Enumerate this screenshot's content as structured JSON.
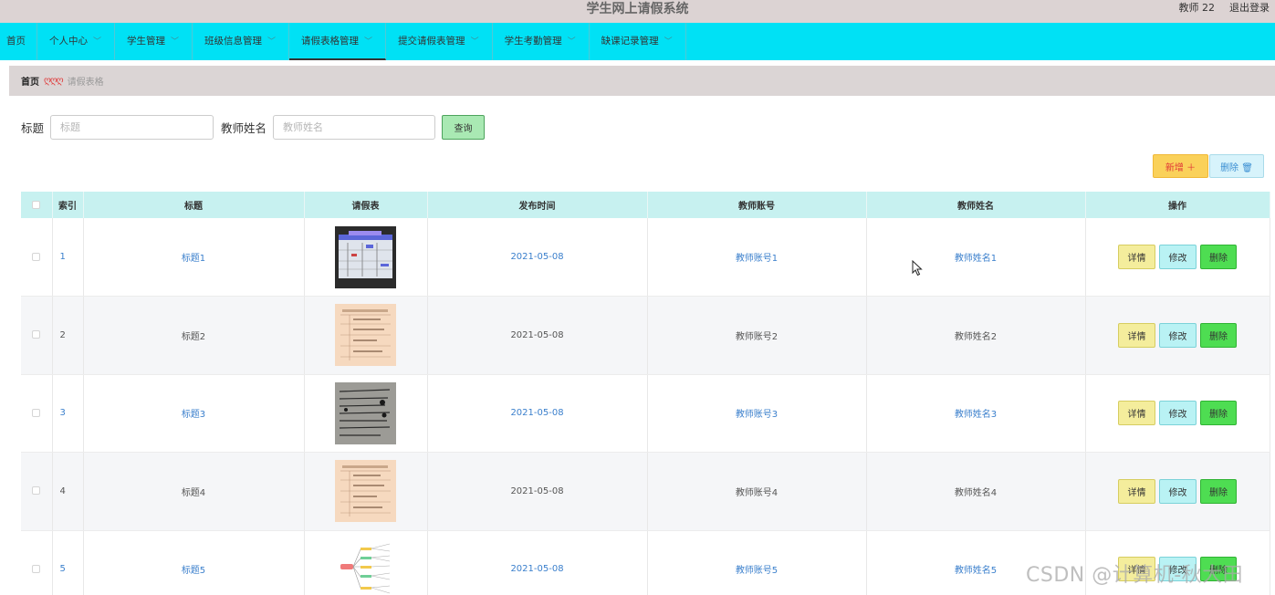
{
  "header": {
    "title": "学生网上请假系统",
    "user": "教师 22",
    "logout": "退出登录"
  },
  "nav": {
    "items": [
      {
        "label": "首页",
        "chevron": false,
        "active": false
      },
      {
        "label": "个人中心",
        "chevron": true,
        "active": false
      },
      {
        "label": "学生管理",
        "chevron": true,
        "active": false
      },
      {
        "label": "班级信息管理",
        "chevron": true,
        "active": false
      },
      {
        "label": "请假表格管理",
        "chevron": true,
        "active": true
      },
      {
        "label": "提交请假表管理",
        "chevron": true,
        "active": false
      },
      {
        "label": "学生考勤管理",
        "chevron": true,
        "active": false
      },
      {
        "label": "缺课记录管理",
        "chevron": true,
        "active": false
      }
    ]
  },
  "breadcrumb": {
    "home": "首页",
    "separator": "ღღღ",
    "current": "请假表格"
  },
  "search": {
    "title_label": "标题",
    "title_placeholder": "标题",
    "teacher_label": "教师姓名",
    "teacher_placeholder": "教师姓名",
    "query_button": "查询"
  },
  "actions": {
    "add": "新增 ＋",
    "delete": "删除 🗑"
  },
  "table": {
    "columns": [
      "索引",
      "标题",
      "请假表",
      "发布时间",
      "教师账号",
      "教师姓名",
      "操作"
    ],
    "rows": [
      {
        "index": "1",
        "title": "标题1",
        "date": "2021-05-08",
        "account": "教师账号1",
        "name": "教师姓名1"
      },
      {
        "index": "2",
        "title": "标题2",
        "date": "2021-05-08",
        "account": "教师账号2",
        "name": "教师姓名2"
      },
      {
        "index": "3",
        "title": "标题3",
        "date": "2021-05-08",
        "account": "教师账号3",
        "name": "教师姓名3"
      },
      {
        "index": "4",
        "title": "标题4",
        "date": "2021-05-08",
        "account": "教师账号4",
        "name": "教师姓名4"
      },
      {
        "index": "5",
        "title": "标题5",
        "date": "2021-05-08",
        "account": "教师账号5",
        "name": "教师姓名5"
      }
    ],
    "row_buttons": {
      "detail": "详情",
      "edit": "修改",
      "delete": "删除"
    }
  },
  "watermark": "CSDN @计算机-秋大田"
}
